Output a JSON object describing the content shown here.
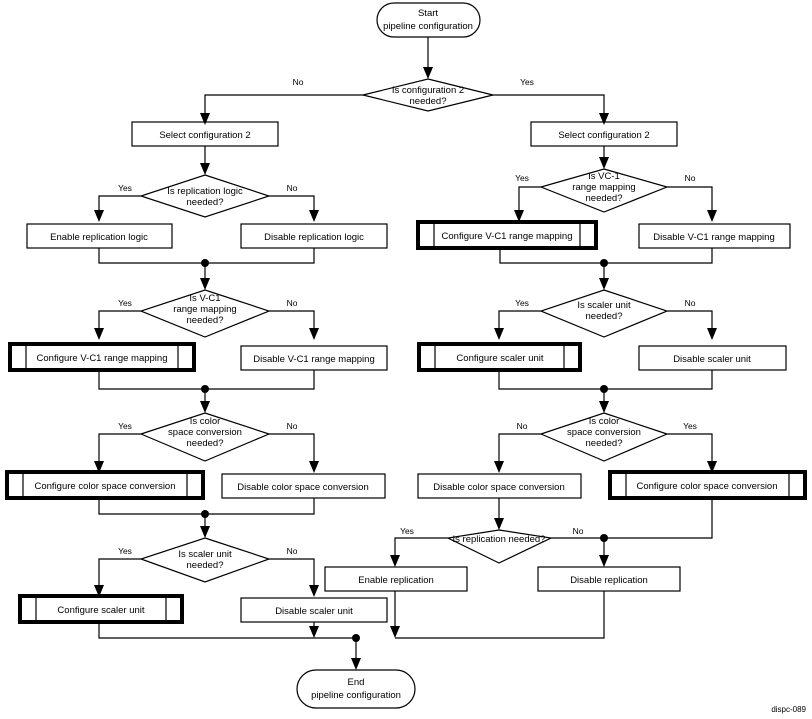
{
  "figure": {
    "footer_label": "dispc-089",
    "colors": {
      "stroke": "#000000",
      "fill": "#ffffff",
      "text": "#000000"
    }
  },
  "terminators": {
    "start": {
      "line1": "Start",
      "line2": "pipeline configuration"
    },
    "end": {
      "line1": "End",
      "line2": "pipeline configuration"
    }
  },
  "decisions": {
    "config2": {
      "line1": "Is configuration 2",
      "line2": "needed?",
      "line3": ""
    },
    "left_replication_logic": {
      "line1": "Is replication logic",
      "line2": "needed?",
      "line3": ""
    },
    "left_vc1": {
      "line1": "Is V-C1",
      "line2": "range mapping",
      "line3": "needed?"
    },
    "left_csc": {
      "line1": "Is color",
      "line2": "space conversion",
      "line3": "needed?"
    },
    "left_scaler": {
      "line1": "Is scaler unit",
      "line2": "needed?",
      "line3": ""
    },
    "right_vc1": {
      "line1": "Is VC-1",
      "line2": "range mapping",
      "line3": "needed?"
    },
    "right_scaler": {
      "line1": "Is scaler unit",
      "line2": "needed?",
      "line3": ""
    },
    "right_csc": {
      "line1": "Is color",
      "line2": "space conversion",
      "line3": "needed?"
    },
    "right_replication": {
      "line1": "Is replication needed?",
      "line2": "",
      "line3": ""
    }
  },
  "processes": {
    "left_select_config": "Select configuration 2",
    "right_select_config": "Select configuration 2",
    "enable_replication_logic": "Enable replication logic",
    "disable_replication_logic": "Disable replication logic",
    "left_configure_vc1": "Configure V-C1 range mapping",
    "left_disable_vc1": "Disable V-C1 range mapping",
    "left_configure_csc": "Configure color space conversion",
    "left_disable_csc": "Disable color space conversion",
    "left_configure_scaler": "Configure scaler unit",
    "left_disable_scaler": "Disable scaler unit",
    "right_configure_vc1": "Configure V-C1 range mapping",
    "right_disable_vc1": "Disable V-C1 range mapping",
    "right_configure_scaler": "Configure scaler unit",
    "right_disable_scaler": "Disable scaler unit",
    "right_disable_csc": "Disable color space conversion",
    "right_configure_csc": "Configure color space conversion",
    "enable_replication": "Enable replication",
    "disable_replication": "Disable replication"
  },
  "edge_labels": {
    "config2_no": "No",
    "config2_yes": "Yes",
    "left_replication_logic_yes": "Yes",
    "left_replication_logic_no": "No",
    "left_vc1_yes": "Yes",
    "left_vc1_no": "No",
    "left_csc_yes": "Yes",
    "left_csc_no": "No",
    "left_scaler_yes": "Yes",
    "left_scaler_no": "No",
    "right_vc1_yes": "Yes",
    "right_vc1_no": "No",
    "right_scaler_yes": "Yes",
    "right_scaler_no": "No",
    "right_csc_no": "No",
    "right_csc_yes": "Yes",
    "right_replication_yes": "Yes",
    "right_replication_no": "No"
  }
}
